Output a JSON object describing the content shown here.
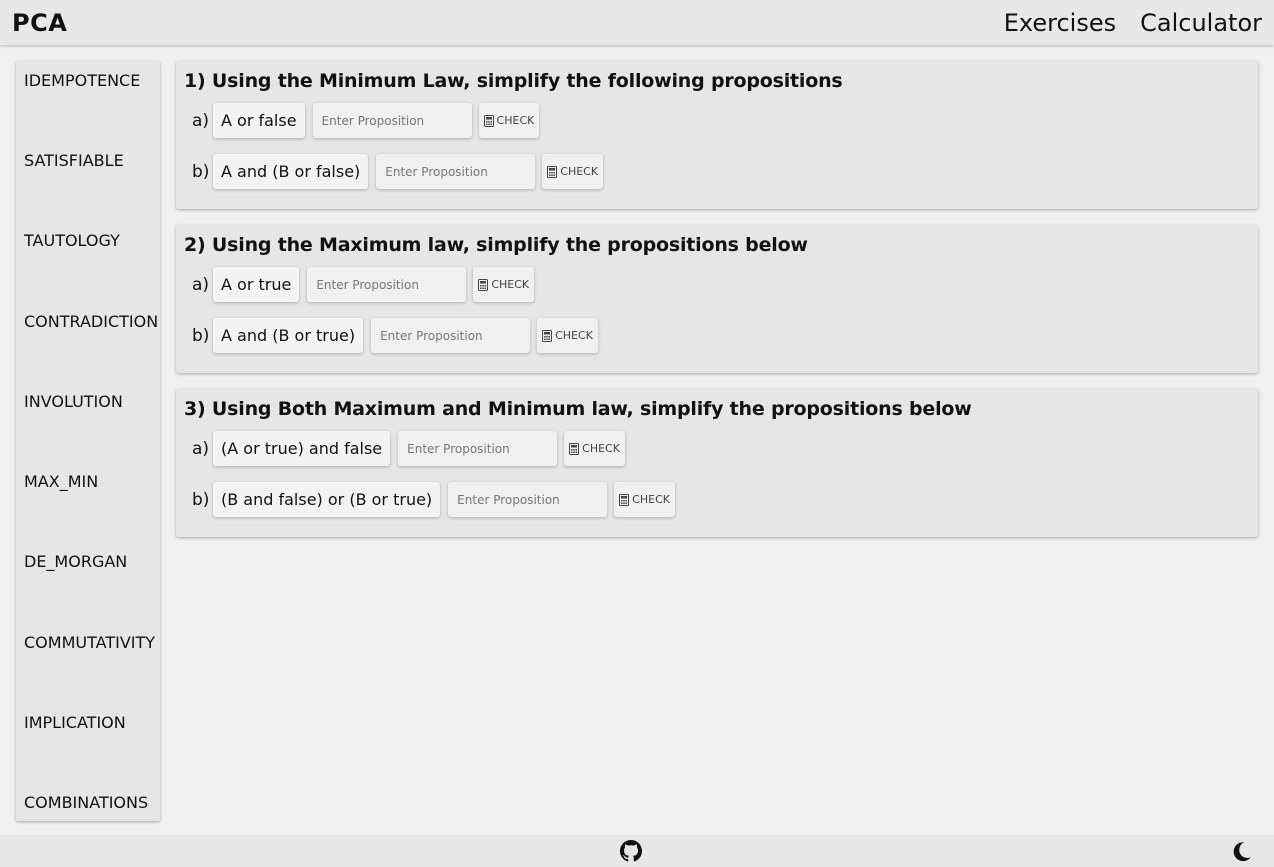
{
  "header": {
    "brand": "PCA",
    "nav": [
      {
        "label": "Exercises"
      },
      {
        "label": "Calculator"
      }
    ]
  },
  "sidebar": {
    "items": [
      {
        "label": "IDEMPOTENCE"
      },
      {
        "label": "SATISFIABLE"
      },
      {
        "label": "TAUTOLOGY"
      },
      {
        "label": "CONTRADICTION"
      },
      {
        "label": "INVOLUTION"
      },
      {
        "label": "MAX_MIN"
      },
      {
        "label": "DE_MORGAN"
      },
      {
        "label": "COMMUTATIVITY"
      },
      {
        "label": "IMPLICATION"
      },
      {
        "label": "COMBINATIONS"
      }
    ]
  },
  "exercises": [
    {
      "title": "1) Using the Minimum Law, simplify the following propositions",
      "rows": [
        {
          "label": "a)",
          "proposition": "A or false",
          "placeholder": "Enter Proposition",
          "check": "CHECK"
        },
        {
          "label": "b)",
          "proposition": "A and (B or false)",
          "placeholder": "Enter Proposition",
          "check": "CHECK"
        }
      ]
    },
    {
      "title": "2) Using the Maximum law, simplify the propositions below",
      "rows": [
        {
          "label": "a)",
          "proposition": "A or true",
          "placeholder": "Enter Proposition",
          "check": "CHECK"
        },
        {
          "label": "b)",
          "proposition": "A and (B or true)",
          "placeholder": "Enter Proposition",
          "check": "CHECK"
        }
      ]
    },
    {
      "title": "3) Using Both Maximum and Minimum law, simplify the propositions below",
      "rows": [
        {
          "label": "a)",
          "proposition": "(A or true) and false",
          "placeholder": "Enter Proposition",
          "check": "CHECK"
        },
        {
          "label": "b)",
          "proposition": "(B and false) or (B or true)",
          "placeholder": "Enter Proposition",
          "check": "CHECK"
        }
      ]
    }
  ],
  "footer": {
    "icons": [
      "github-icon",
      "moon-icon"
    ]
  }
}
